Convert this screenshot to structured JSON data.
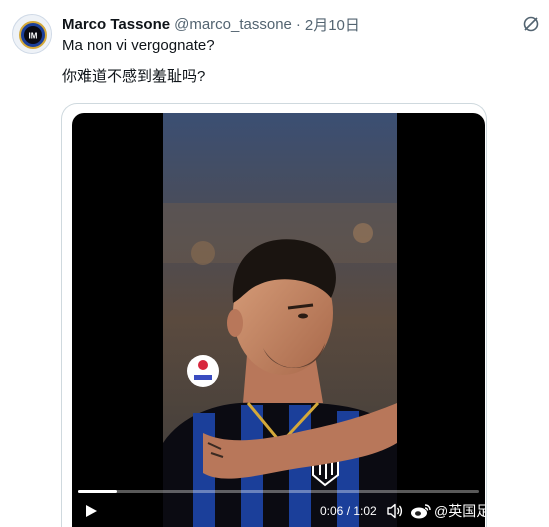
{
  "author": {
    "name": "Marco Tassone",
    "handle": "@marco_tassone",
    "separator": "·",
    "date": "2月10日"
  },
  "tweet": {
    "lines": [
      "Ma non vi vergognate?",
      "你难道不感到羞耻吗?"
    ]
  },
  "video": {
    "current_time": "0:06",
    "duration": "1:02",
    "timecode": "0:06 / 1:02",
    "progress_fraction": 0.097,
    "watermark": "@英国足球那点事"
  },
  "icons": {
    "avatar": "inter-crest-icon",
    "grok": "grok-icon",
    "play": "play-icon",
    "volume": "volume-icon",
    "watermark": "weibo-icon"
  },
  "colors": {
    "text": "#0f1419",
    "secondary": "#536471",
    "border": "#cfd9de",
    "video_bg": "#000000",
    "jersey_blue": "#1b3f9a",
    "jersey_black": "#0b0b12"
  }
}
